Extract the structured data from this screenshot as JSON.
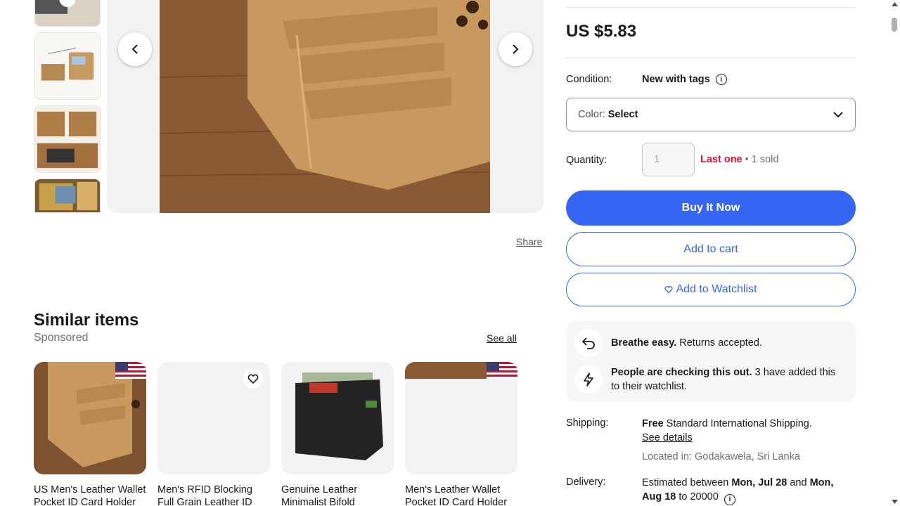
{
  "gallery": {
    "thumbnail_count": 4,
    "prev_icon": "chevron-left-icon",
    "next_icon": "chevron-right-icon"
  },
  "share": {
    "label": "Share"
  },
  "similar": {
    "title": "Similar items",
    "subtitle": "Sponsored",
    "see_all": "See all",
    "cards": [
      {
        "title": "US Men's Leather Wallet Pocket ID Card Holder"
      },
      {
        "title": "Men's RFID Blocking Full Grain Leather ID"
      },
      {
        "title": "Genuine Leather Minimalist Bifold"
      },
      {
        "title": "Men's Leather Wallet Pocket ID Card Holder"
      }
    ]
  },
  "item": {
    "price": "US $5.83",
    "condition_label": "Condition:",
    "condition_value": "New with tags",
    "color_label": "Color:",
    "color_value": "Select",
    "quantity_label": "Quantity:",
    "quantity_placeholder": "1",
    "stock_status": "Last one",
    "separator": " • ",
    "sold": "1 sold",
    "buy_now": "Buy It Now",
    "add_to_cart": "Add to cart",
    "add_to_watchlist": "Add to Watchlist"
  },
  "highlights": {
    "returns_bold": "Breathe easy.",
    "returns_text": " Returns accepted.",
    "watch_bold": "People are checking this out.",
    "watch_text": " 3 have added this to their watchlist."
  },
  "shipping": {
    "label": "Shipping:",
    "free": "Free",
    "text": " Standard International Shipping.",
    "see_details": "See details",
    "located": "Located in: Godakawela, Sri Lanka"
  },
  "delivery": {
    "label": "Delivery:",
    "prefix": "Estimated between ",
    "date1": "Mon, Jul 28",
    "mid": " and ",
    "date2": "Mon, Aug 18",
    "suffix": " to 20000"
  },
  "colors": {
    "accent": "#3665f3",
    "urgent": "#e0102a",
    "leather": "#c9985f"
  }
}
